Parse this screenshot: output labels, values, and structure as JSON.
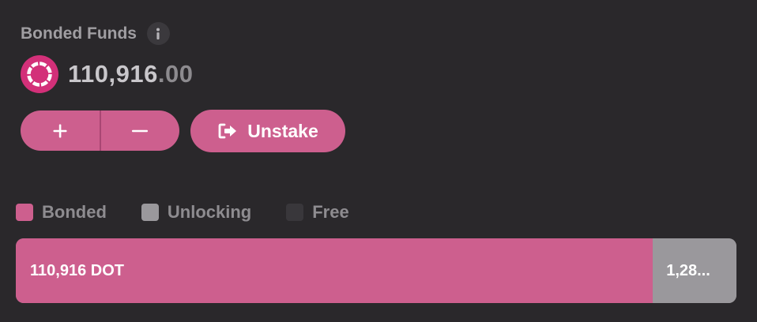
{
  "heading": {
    "title": "Bonded Funds",
    "info_icon": "info-icon"
  },
  "balance": {
    "integer": "110,916",
    "decimal": ".00",
    "token_icon": "polkadot-logo-icon"
  },
  "actions": {
    "bond_extra_icon": "plus-icon",
    "unbond_icon": "minus-icon",
    "unstake_label": "Unstake",
    "unstake_icon": "sign-out-icon"
  },
  "legend": [
    {
      "label": "Bonded",
      "color": "#cd5f8e"
    },
    {
      "label": "Unlocking",
      "color": "#9a989c"
    },
    {
      "label": "Free",
      "color": "#39373b"
    }
  ],
  "funds_bar": {
    "bonded_label": "110,916 DOT",
    "unlocking_label": "1,28...",
    "bonded_fraction": 0.884
  },
  "colors": {
    "accent": "#cd5f8e",
    "background": "#2a282b",
    "muted": "#9a989c"
  }
}
